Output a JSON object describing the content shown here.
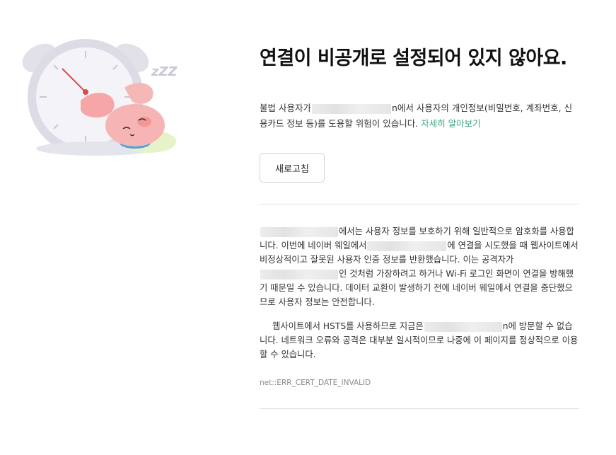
{
  "title": "연결이 비공개로 설정되어 있지 않아요.",
  "description": {
    "part1": "불법 사용자가",
    "part2": "n에서 사용자의 개인정보(비밀번호, 계좌번호, 신용카드 정보 등)를 도용할 위험이 있습니다.",
    "learn_more_link": "자세히 알아보기"
  },
  "refresh_button": "새로고침",
  "details": {
    "para1_a": "에서는 사용자 정보를 보호하기 위해 일반적으로 암호화를 사용합니다. 이번에 네이버 웨일에서",
    "para1_b": "에 연결을 시도했을 때 웹사이트에서 비정상적이고 잘못된 사용자 인증 정보를 반환했습니다. 이는 공격자가",
    "para1_c": "인 것처럼 가장하려고 하거나 Wi-Fi 로그인 화면이 연결을 방해했기 때문일 수 있습니다. 데이터 교환이 발생하기 전에 네이버 웨일에서 연결을 중단했으므로 사용자 정보는 안전합니다.",
    "para2_a": "웹사이트에서 HSTS를 사용하므로 지금은",
    "para2_b": "n에 방문할 수 없습니다. 네트워크 오류와 공격은 대부분 일시적이므로 나중에 이 페이지를 정상적으로 이용할 수 있습니다.",
    "error_code": "net::ERR_CERT_DATE_INVALID"
  },
  "illustration": {
    "icon": "sleeping-clock-rabbit-illustration",
    "zzz": "zZZ",
    "colors": {
      "clock": "#dcdbe6",
      "rabbit": "#f6a6a6",
      "link": "#3aa680"
    }
  }
}
